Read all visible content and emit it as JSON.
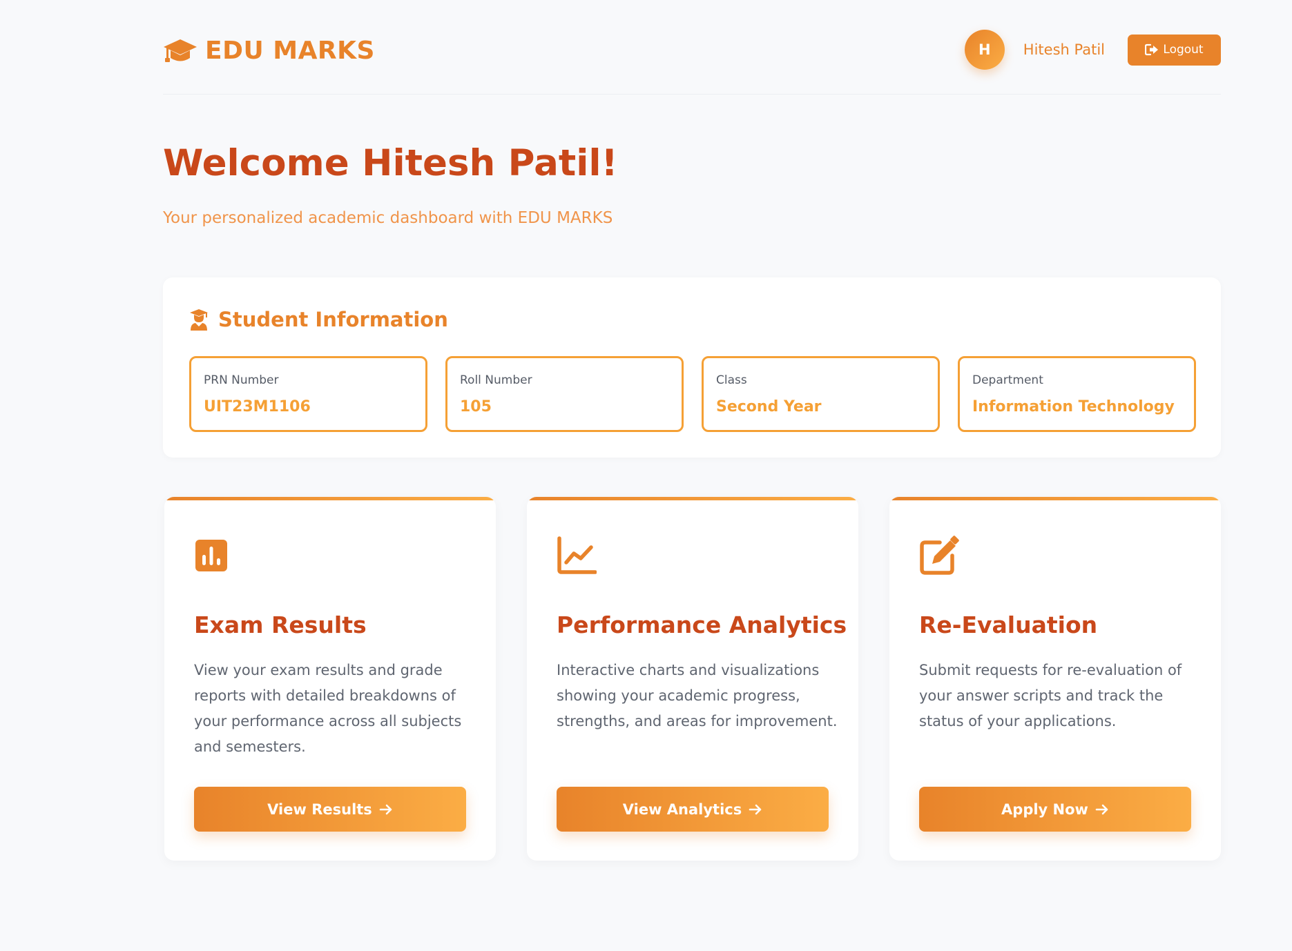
{
  "brand": {
    "name": "EDU MARKS",
    "icon": "graduation-cap-icon",
    "accent_color": "#e8832a",
    "title_color": "#c9481a"
  },
  "user": {
    "initial": "H",
    "name": "Hitesh Patil",
    "logout_label": "Logout",
    "logout_icon": "sign-out-icon"
  },
  "welcome": {
    "title": "Welcome Hitesh Patil!",
    "subtitle": "Your personalized academic dashboard with EDU MARKS"
  },
  "student_info": {
    "heading": "Student Information",
    "icon": "student-icon",
    "fields": [
      {
        "label": "PRN Number",
        "value": "UIT23M1106"
      },
      {
        "label": "Roll Number",
        "value": "105"
      },
      {
        "label": "Class",
        "value": "Second Year"
      },
      {
        "label": "Department",
        "value": "Information Technology"
      }
    ]
  },
  "cards": [
    {
      "icon": "bar-chart-icon",
      "title": "Exam Results",
      "description": "View your exam results and grade reports with detailed breakdowns of your performance across all subjects and semesters.",
      "button": "View Results"
    },
    {
      "icon": "line-chart-icon",
      "title": "Performance Analytics",
      "description": "Interactive charts and visualizations showing your academic progress, strengths, and areas for improvement.",
      "button": "View Analytics"
    },
    {
      "icon": "edit-icon",
      "title": "Re-Evaluation",
      "description": "Submit requests for re-evaluation of your answer scripts and track the status of your applications.",
      "button": "Apply Now"
    }
  ]
}
